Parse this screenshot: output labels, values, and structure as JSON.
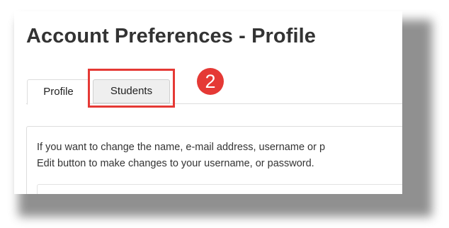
{
  "page": {
    "title": "Account Preferences - Profile"
  },
  "tabs": [
    {
      "label": "Profile",
      "active": true
    },
    {
      "label": "Students",
      "active": false
    }
  ],
  "annotation": {
    "step_number": "2",
    "color": "#e53935"
  },
  "content": {
    "line1": "If you want to change the name, e-mail address, username or p",
    "line2": "Edit button to make changes to your username, or password."
  },
  "colors": {
    "tab_border": "#dddddd",
    "inactive_tab_bg": "#efefef",
    "text": "#333333"
  }
}
